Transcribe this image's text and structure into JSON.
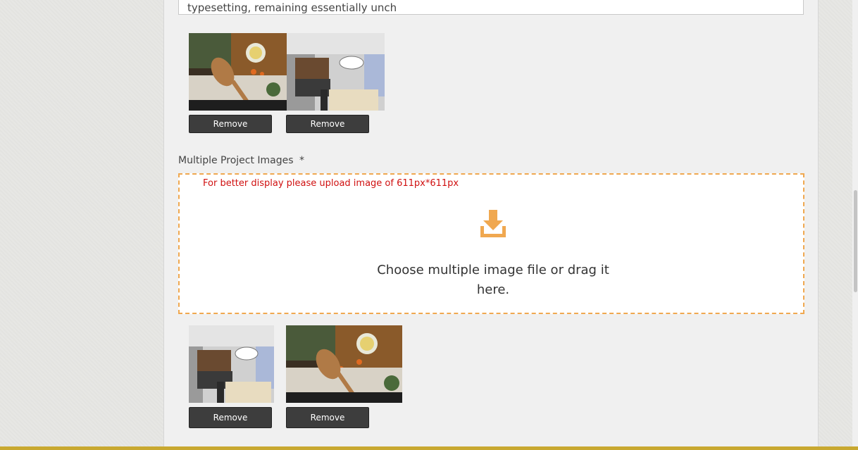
{
  "form": {
    "description_text": "typesetting, remaining essentially unch",
    "single_images": {
      "items": [
        {
          "image": "kitchen-spoon-herbs-photo",
          "remove_label": "Remove"
        },
        {
          "image": "modern-kitchen-interior-photo",
          "remove_label": "Remove"
        }
      ]
    },
    "multiple_images": {
      "label": "Multiple Project Images",
      "required_marker": "*",
      "hint": "For better display please upload image of 611px*611px",
      "dropzone_icon": "download-icon",
      "dropzone_text": "Choose multiple image file or drag it here.",
      "items": [
        {
          "image": "modern-kitchen-interior-photo",
          "remove_label": "Remove"
        },
        {
          "image": "kitchen-spoon-herbs-photo",
          "remove_label": "Remove"
        }
      ]
    }
  },
  "colors": {
    "accent": "#f0a850",
    "hint_red": "#d01010",
    "button_dark": "#3d3d3d"
  }
}
